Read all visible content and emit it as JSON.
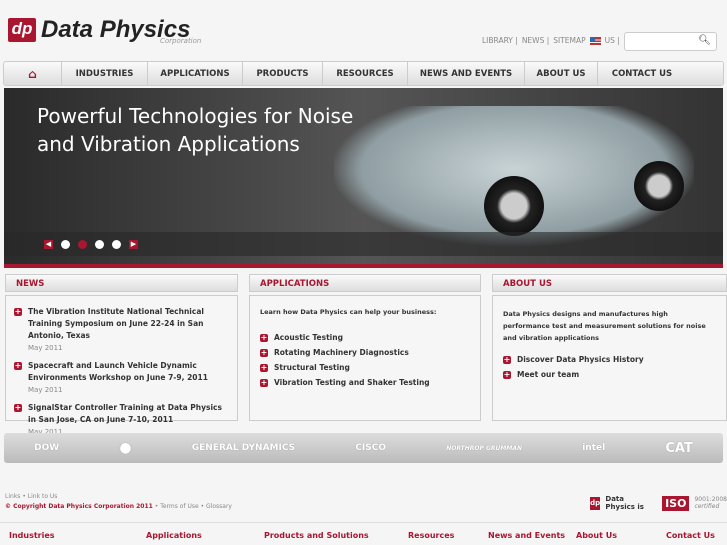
{
  "logo": {
    "mark": "dp",
    "name": "Data Physics",
    "sub": "Corporation"
  },
  "toplinks": [
    "LIBRARY |",
    "NEWS |",
    "SITEMAP",
    "US |"
  ],
  "nav": [
    "INDUSTRIES",
    "APPLICATIONS",
    "PRODUCTS",
    "RESOURCES",
    "NEWS AND EVENTS",
    "ABOUT US",
    "CONTACT US"
  ],
  "hero": {
    "title": "Powerful Technologies for Noise and Vibration Applications"
  },
  "news": {
    "title": "NEWS",
    "items": [
      {
        "text": "The Vibration Institute National Technical Training Symposium on June 22-24 in San Antonio, Texas",
        "date": "May 2011"
      },
      {
        "text": "Spacecraft and Launch Vehicle Dynamic Environments Workshop on June 7-9, 2011",
        "date": "May 2011"
      },
      {
        "text": "SignalStar Controller Training at Data Physics in San Jose, CA on June 7-10, 2011",
        "date": "May 2011"
      }
    ]
  },
  "applications": {
    "title": "APPLICATIONS",
    "intro": "Learn how Data Physics can help your business:",
    "items": [
      "Acoustic Testing",
      "Rotating Machinery Diagnostics",
      "Structural Testing",
      "Vibration Testing and Shaker Testing"
    ]
  },
  "about": {
    "title": "ABOUT US",
    "intro": "Data Physics designs and manufactures high performance test and measurement solutions for noise and vibration applications",
    "items": [
      "Discover Data Physics History",
      "Meet our team"
    ]
  },
  "clients": [
    "DOW",
    "",
    "GENERAL DYNAMICS",
    "CISCO",
    "NORTHROP GRUMMAN",
    "intel",
    "CAT"
  ],
  "footer": {
    "links": "Links • Link to Us",
    "copyright": "© Copyright Data Physics Corporation 2011",
    "terms": " • Terms of Use • Glossary",
    "iso_text": "Data Physics is",
    "iso": "ISO",
    "iso_std": "9001:2008",
    "iso_cert": "certified",
    "columns": [
      "Industries",
      "Applications",
      "Products and Solutions",
      "Resources",
      "News and Events",
      "About Us",
      "Contact Us"
    ]
  }
}
